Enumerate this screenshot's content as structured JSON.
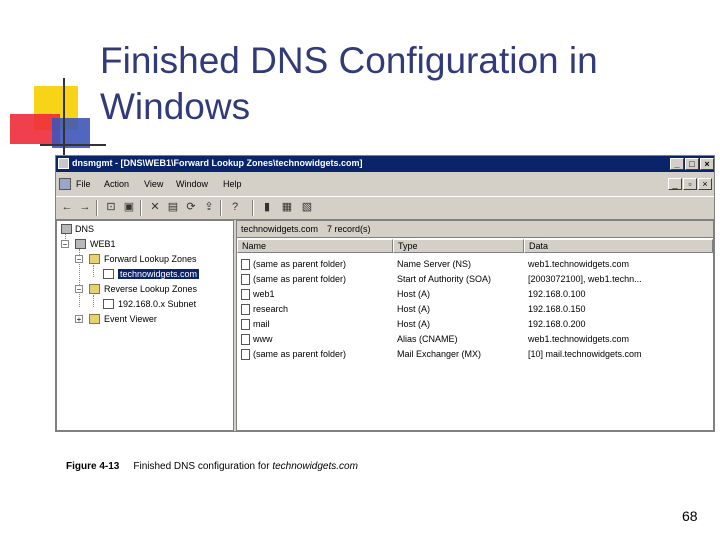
{
  "slide": {
    "title_line1": "Finished DNS Configuration in",
    "title_line2": "Windows",
    "page_number": "68"
  },
  "window": {
    "title": "dnsmgmt - [DNS\\WEB1\\Forward Lookup Zones\\technowidgets.com]",
    "buttons": {
      "minimize": "_",
      "restore": "□",
      "close": "×"
    },
    "child_buttons": {
      "minimize": "_",
      "restore": "▫",
      "close": "×"
    }
  },
  "menu": [
    "File",
    "Action",
    "View",
    "Window",
    "Help"
  ],
  "toolbar_icons": [
    "back-icon",
    "forward-icon",
    "up-icon",
    "show-tree-icon",
    "delete-icon",
    "properties-icon",
    "refresh-icon",
    "export-icon",
    "help-icon",
    "server-icon",
    "zone-icon",
    "record-icon"
  ],
  "tree": {
    "root": "DNS",
    "server": "WEB1",
    "forward": "Forward Lookup Zones",
    "zone": "technowidgets.com",
    "reverse": "Reverse Lookup Zones",
    "subnet": "192.168.0.x Subnet",
    "events": "Event Viewer"
  },
  "list": {
    "zone_name": "technowidgets.com",
    "record_count": "7 record(s)",
    "columns": [
      "Name",
      "Type",
      "Data"
    ],
    "rows": [
      {
        "name": "(same as parent folder)",
        "type": "Name Server (NS)",
        "data": "web1.technowidgets.com"
      },
      {
        "name": "(same as parent folder)",
        "type": "Start of Authority (SOA)",
        "data": "[2003072100], web1.techn..."
      },
      {
        "name": "web1",
        "type": "Host (A)",
        "data": "192.168.0.100"
      },
      {
        "name": "research",
        "type": "Host (A)",
        "data": "192.168.0.150"
      },
      {
        "name": "mail",
        "type": "Host (A)",
        "data": "192.168.0.200"
      },
      {
        "name": "www",
        "type": "Alias (CNAME)",
        "data": "web1.technowidgets.com"
      },
      {
        "name": "(same as parent folder)",
        "type": "Mail Exchanger (MX)",
        "data": "[10] mail.technowidgets.com"
      }
    ]
  },
  "caption": {
    "figure": "Figure 4-13",
    "text": "Finished DNS configuration for ",
    "emphasis": "technowidgets.com"
  }
}
